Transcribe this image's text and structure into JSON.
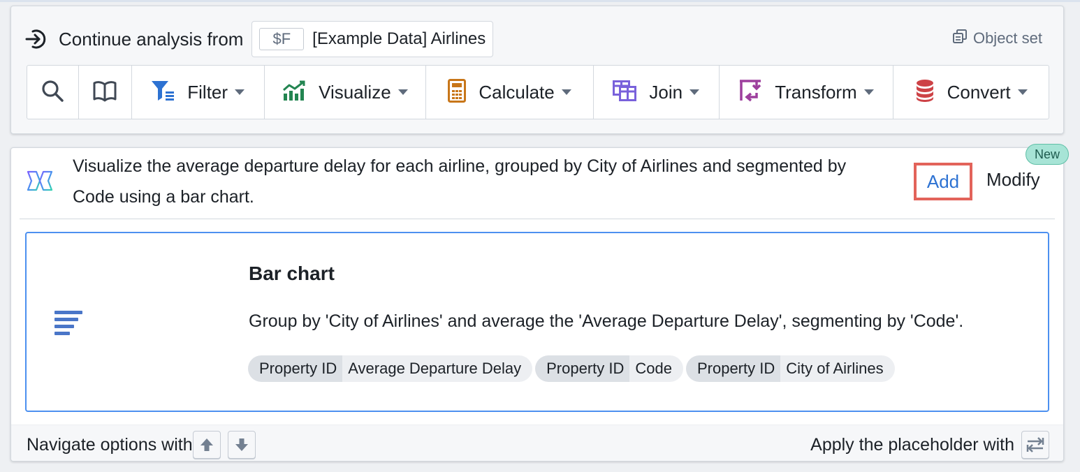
{
  "header": {
    "continue_label": "Continue analysis from",
    "variable": "$F",
    "source_name": "[Example Data] Airlines",
    "object_set_label": "Object set"
  },
  "toolbar": {
    "buttons": [
      {
        "label": "",
        "icon": "search-icon"
      },
      {
        "label": "",
        "icon": "book-icon"
      },
      {
        "label": "Filter",
        "icon": "filter-icon",
        "color": "#2d72d2"
      },
      {
        "label": "Visualize",
        "icon": "chart-trend-icon",
        "color": "#238551"
      },
      {
        "label": "Calculate",
        "icon": "calculator-icon",
        "color": "#c87619"
      },
      {
        "label": "Join",
        "icon": "join-table-icon",
        "color": "#7961db"
      },
      {
        "label": "Transform",
        "icon": "transform-icon",
        "color": "#9d3f9d"
      },
      {
        "label": "Convert",
        "icon": "database-icon",
        "color": "#cd4246"
      }
    ]
  },
  "suggestion": {
    "text": "Visualize the average departure delay for each airline, grouped by City of Airlines and segmented by Code using a bar chart.",
    "badge": "New",
    "add_label": "Add",
    "modify_label": "Modify"
  },
  "option": {
    "title": "Bar chart",
    "description": "Group by 'City of Airlines' and average the 'Average Departure Delay', segmenting by 'Code'.",
    "tags": [
      {
        "key": "Property ID",
        "value": "Average Departure Delay"
      },
      {
        "key": "Property ID",
        "value": "Code"
      },
      {
        "key": "Property ID",
        "value": "City of Airlines"
      }
    ]
  },
  "footer": {
    "navigate_label": "Navigate options with",
    "apply_label": "Apply the placeholder with"
  },
  "colors": {
    "accent_blue": "#2d72d2",
    "highlight_red": "#e2635a",
    "badge_green": "#a7e4d6"
  }
}
